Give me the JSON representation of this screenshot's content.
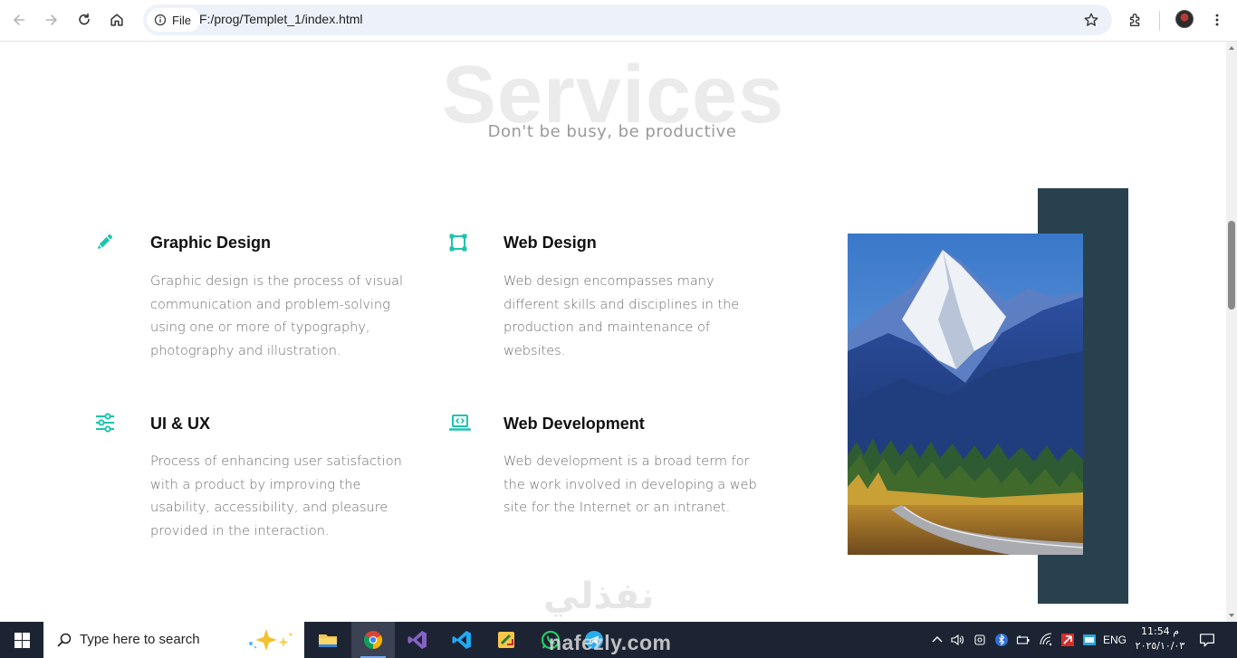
{
  "browser": {
    "site_chip_label": "File",
    "url": "F:/prog/Templet_1/index.html",
    "icons": [
      "back-arrow-icon",
      "forward-arrow-icon",
      "reload-icon",
      "home-icon",
      "info-icon",
      "star-icon",
      "extensions-icon",
      "profile-avatar",
      "menu-kebab-icon"
    ]
  },
  "services_section": {
    "background_title": "Services",
    "subtitle": "Don't be busy, be productive",
    "accent_color": "#1fc3ae",
    "dark_block_color": "#28414f",
    "items": [
      {
        "title": "Graphic Design",
        "icon": "pencil-icon",
        "description": "Graphic design is the process of visual communication and problem-solving using one or more of typography, photography and illustration."
      },
      {
        "title": "Web Design",
        "icon": "vector-square-icon",
        "description": "Web design encompasses many different skills and disciplines in the production and maintenance of websites."
      },
      {
        "title": "UI & UX",
        "icon": "sliders-icon",
        "description": "Process of enhancing user satisfaction with a product by improving the usability, accessibility, and pleasure provided in the interaction."
      },
      {
        "title": "Web Development",
        "icon": "laptop-code-icon",
        "description": "Web development is a broad term for the work involved in developing a web site for the Internet or an intranet."
      }
    ]
  },
  "watermark": {
    "arabic_text": "نفذلي",
    "latin_text": "nafezly.com"
  },
  "taskbar": {
    "search_placeholder": "Type here to search",
    "apps": [
      "file-explorer-icon",
      "chrome-icon",
      "visual-studio-icon",
      "vscode-icon",
      "sticky-app-icon",
      "whatsapp-icon",
      "telegram-icon"
    ],
    "language": "ENG",
    "time": "11:54 م",
    "date": "٢٠٢٥/١٠/٠٣"
  }
}
